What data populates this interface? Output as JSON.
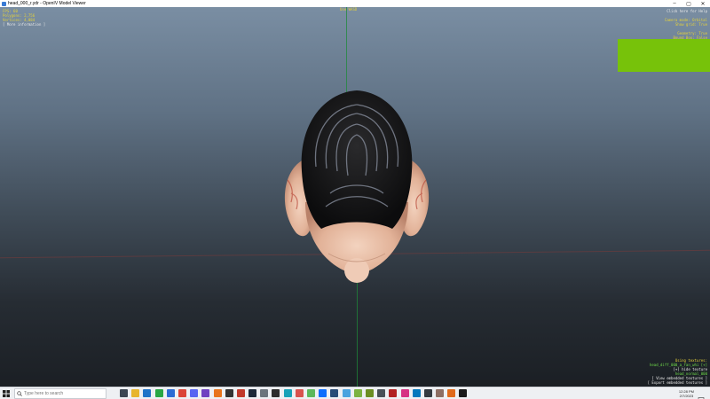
{
  "window": {
    "title": "head_000_r.ydr - OpenIV Model Viewer",
    "minimize": "–",
    "maximize": "▢",
    "close": "✕"
  },
  "hud": {
    "top_left": {
      "fps": "FPS: 60",
      "polygons": "Polygons: 2,756",
      "vertices": "Vertices: 4,084",
      "more_info": "[ More information ]"
    },
    "top_center": "Use WASD",
    "top_right": {
      "help": "Click here for Help",
      "camera_mode": "Camera mode: Orbital",
      "show_grid": "Show grid: True",
      "geometry": "Geometry: True",
      "bound_box": "Bound Box: False",
      "display_normals": "Display Normals: False"
    },
    "bottom_right": {
      "using_textures": "Using textures:",
      "texture_name": "head_diff_000_a_fan_whi [+]",
      "hide_texture": "[+] hide texture",
      "normal_name": "head_normal_000",
      "view_embedded": "[ View embedded textures ]",
      "export_embedded": "[ Export embedded textures ]"
    }
  },
  "colors": {
    "accent_box": "#77c20a",
    "hud_yellow": "#e6d23a",
    "hud_green": "#6fdc4a"
  },
  "taskbar": {
    "search_placeholder": "Type here to search",
    "clock_time": "12:28 PM",
    "clock_date": "2/7/2023",
    "icons": [
      {
        "name": "task-view-icon",
        "color": "#3b4652"
      },
      {
        "name": "file-explorer-icon",
        "color": "#e7b52c"
      },
      {
        "name": "app-icon-blue",
        "color": "#1e73c8"
      },
      {
        "name": "xbox-icon",
        "color": "#28a745"
      },
      {
        "name": "store-icon",
        "color": "#2b6cd4"
      },
      {
        "name": "chrome-icon",
        "color": "#db4437"
      },
      {
        "name": "discord-icon",
        "color": "#5865f2"
      },
      {
        "name": "app-icon-purple",
        "color": "#6f42c1"
      },
      {
        "name": "app-icon-orange",
        "color": "#e8741c"
      },
      {
        "name": "epic-games-icon",
        "color": "#333333"
      },
      {
        "name": "app-icon-red",
        "color": "#c0392b"
      },
      {
        "name": "steam-icon",
        "color": "#1b2838"
      },
      {
        "name": "app-icon-gray",
        "color": "#6c757d"
      },
      {
        "name": "app-icon-dark",
        "color": "#2c2c2c"
      },
      {
        "name": "app-icon-teal",
        "color": "#17a2b8"
      },
      {
        "name": "media-icon",
        "color": "#d9534f"
      },
      {
        "name": "app-icon-green",
        "color": "#5cb85c"
      },
      {
        "name": "app-icon-blue2",
        "color": "#0d6efd"
      },
      {
        "name": "app-icon-navy",
        "color": "#274c77"
      },
      {
        "name": "app-icon-sky",
        "color": "#4aa3df"
      },
      {
        "name": "app-icon-lime",
        "color": "#7cb342"
      },
      {
        "name": "minecraft-icon",
        "color": "#6b8e23"
      },
      {
        "name": "app-icon-slate",
        "color": "#495057"
      },
      {
        "name": "app-icon-crimson",
        "color": "#b22222"
      },
      {
        "name": "app-icon-pink",
        "color": "#d63384"
      },
      {
        "name": "app-icon-ocean",
        "color": "#0277bd"
      },
      {
        "name": "app-icon-charcoal",
        "color": "#343a40"
      },
      {
        "name": "app-icon-brown",
        "color": "#8d6e63"
      },
      {
        "name": "openiv-icon",
        "color": "#e06a1b"
      },
      {
        "name": "terminal-icon",
        "color": "#1a1a1a"
      }
    ]
  }
}
